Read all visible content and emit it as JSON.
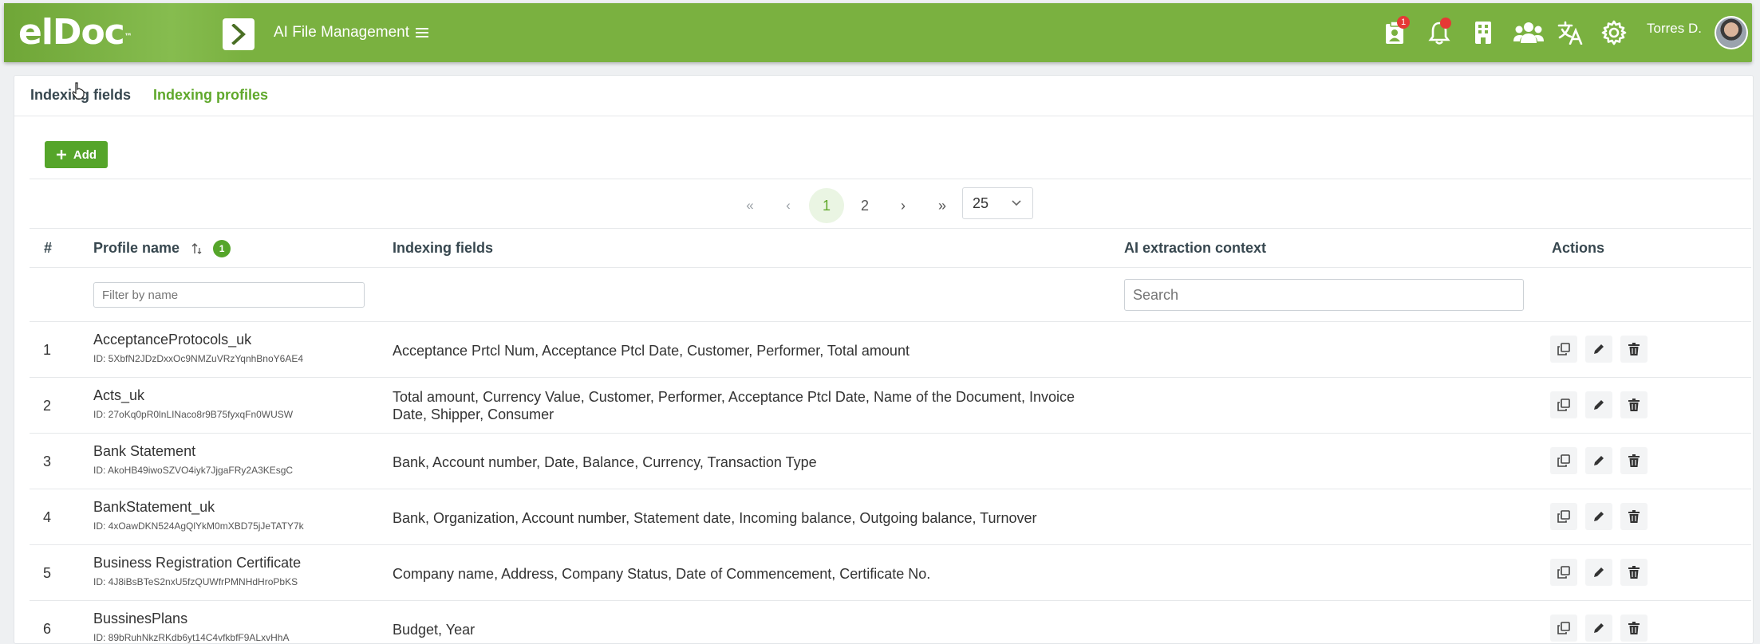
{
  "header": {
    "logo": "elDoc",
    "logo_tm": "™",
    "app_title": "AI File Management",
    "user_name": "Torres D.",
    "task_badge": "1"
  },
  "tabs": [
    {
      "label": "Indexing fields"
    },
    {
      "label": "Indexing profiles"
    }
  ],
  "toolbar": {
    "add_label": "Add"
  },
  "pager": {
    "first": "«",
    "prev": "‹",
    "pages": [
      "1",
      "2"
    ],
    "next": "›",
    "last": "»",
    "per_page": "25"
  },
  "table": {
    "headers": {
      "num": "#",
      "name": "Profile name",
      "name_badge": "1",
      "fields": "Indexing fields",
      "context": "AI extraction context",
      "actions": "Actions"
    },
    "filters": {
      "name_placeholder": "Filter by name",
      "context_placeholder": "Search"
    },
    "rows": [
      {
        "num": "1",
        "name": "AcceptanceProtocols_uk",
        "id": "ID: 5XbfN2JDzDxxOc9NMZuVRzYqnhBnoY6AE4",
        "fields": "Acceptance Prtcl Num, Acceptance Ptcl Date, Customer, Performer, Total amount"
      },
      {
        "num": "2",
        "name": "Acts_uk",
        "id": "ID: 27oKq0pR0lnLINaco8r9B75fyxqFn0WUSW",
        "fields": "Total amount, Currency Value, Customer, Performer, Acceptance Ptcl Date, Name of the Document, Invoice Date, Shipper, Consumer"
      },
      {
        "num": "3",
        "name": "Bank Statement",
        "id": "ID: AkoHB49iwoSZVO4iyk7JjgaFRy2A3KEsgC",
        "fields": "Bank, Account number, Date, Balance, Currency, Transaction Type"
      },
      {
        "num": "4",
        "name": "BankStatement_uk",
        "id": "ID: 4xOawDKN524AgQlYkM0mXBD75jJeTATY7k",
        "fields": "Bank, Organization, Account number, Statement date, Incoming balance, Outgoing balance, Turnover"
      },
      {
        "num": "5",
        "name": "Business Registration Certificate",
        "id": "ID: 4J8iBsBTeS2nxU5fzQUWfrPMNHdHroPbKS",
        "fields": "Company name, Address, Company Status, Date of Commencement, Certificate No."
      },
      {
        "num": "6",
        "name": "BussinesPlans",
        "id": "ID: 89bRuhNkzRKdb6yt14C4vfkbfF9ALxvHhA",
        "fields": "Budget, Year"
      }
    ]
  },
  "colors": {
    "header_green": "#7ab140",
    "accent_green": "#5fa82b",
    "button_green": "#55a52a",
    "badge_red": "#e53935"
  },
  "icons": {
    "header": [
      "clipboard-user-icon",
      "bell-icon",
      "building-icon",
      "users-icon",
      "translate-icon",
      "gear-icon"
    ],
    "row_actions": [
      "copy-icon",
      "edit-icon",
      "delete-icon"
    ]
  }
}
